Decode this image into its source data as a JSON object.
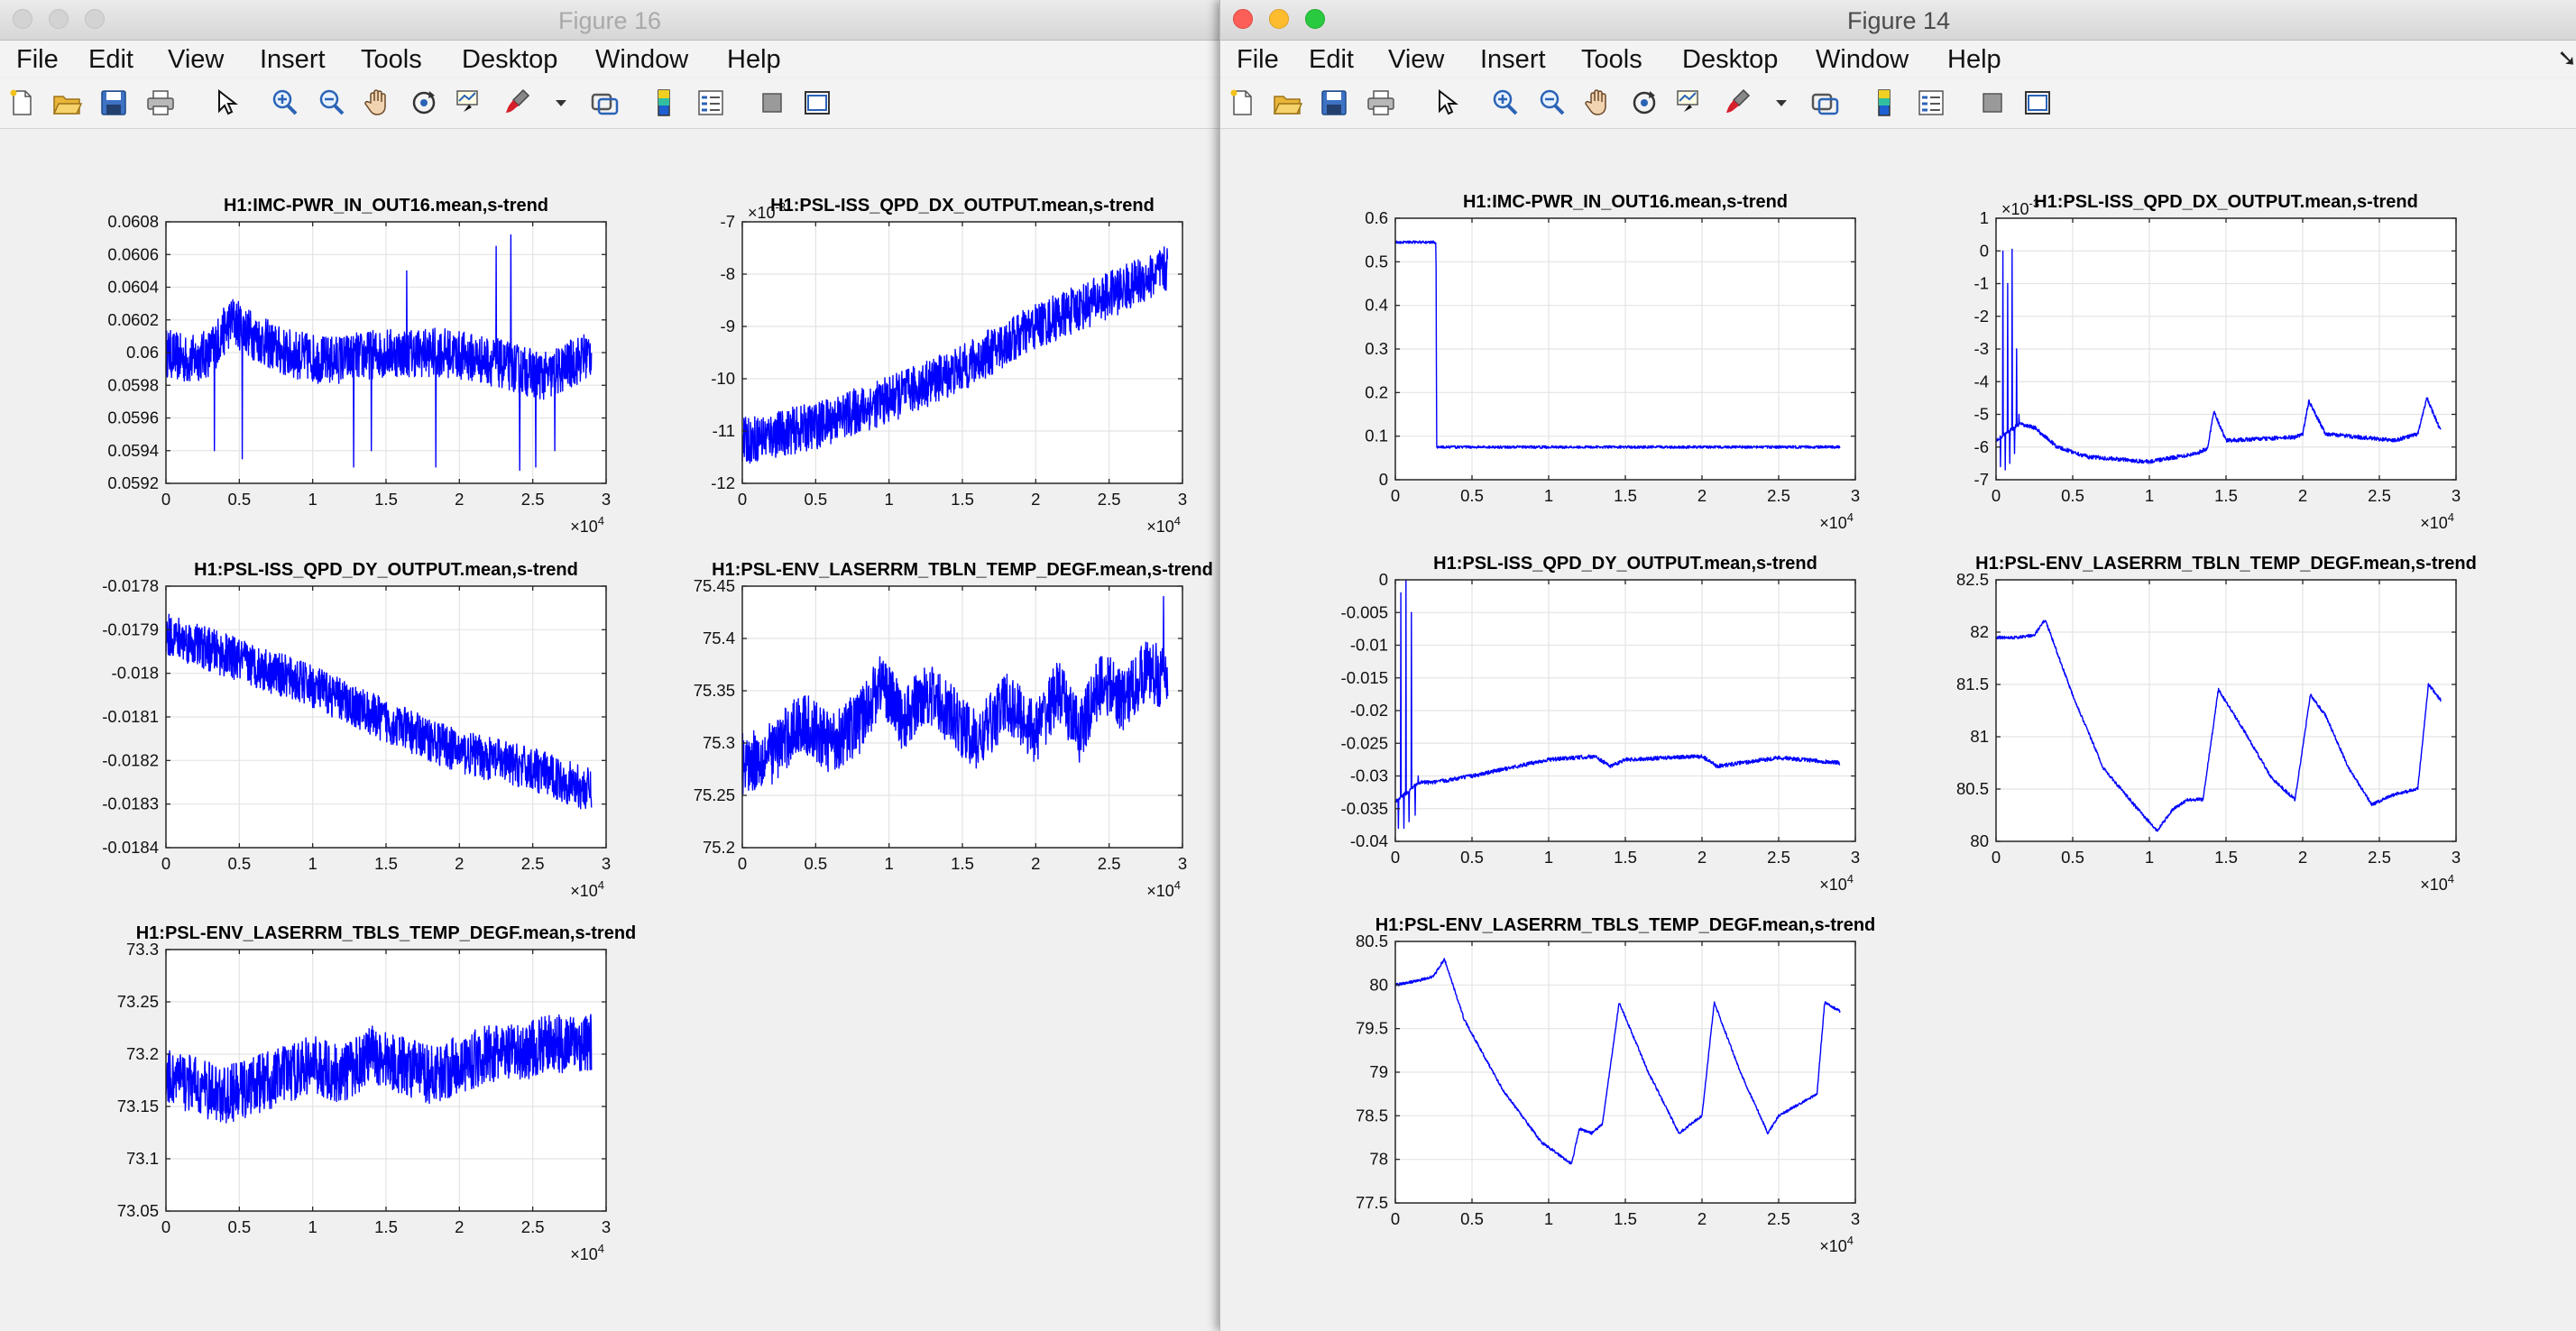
{
  "windows": [
    {
      "id": "figure-16",
      "title": "Figure 16",
      "active": false,
      "menus": [
        "File",
        "Edit",
        "View",
        "Insert",
        "Tools",
        "Desktop",
        "Window",
        "Help"
      ],
      "toolbar_icons": [
        "new-figure-icon",
        "open-file-icon",
        "save-icon",
        "print-icon",
        "edit-plot-pointer-icon",
        "zoom-in-icon",
        "zoom-out-icon",
        "pan-hand-icon",
        "rotate-3d-icon",
        "data-cursor-icon",
        "brush-icon",
        "brush-dropdown-icon",
        "link-plot-icon",
        "insert-colorbar-icon",
        "insert-legend-icon",
        "hide-plot-tools-icon",
        "show-plot-tools-icon"
      ]
    },
    {
      "id": "figure-14",
      "title": "Figure 14",
      "active": true,
      "menus": [
        "File",
        "Edit",
        "View",
        "Insert",
        "Tools",
        "Desktop",
        "Window",
        "Help"
      ],
      "toolbar_icons": [
        "new-figure-icon",
        "open-file-icon",
        "save-icon",
        "print-icon",
        "edit-plot-pointer-icon",
        "zoom-in-icon",
        "zoom-out-icon",
        "pan-hand-icon",
        "rotate-3d-icon",
        "data-cursor-icon",
        "brush-icon",
        "brush-dropdown-icon",
        "link-plot-icon",
        "insert-colorbar-icon",
        "insert-legend-icon",
        "hide-plot-tools-icon",
        "show-plot-tools-icon"
      ]
    }
  ],
  "colors": {
    "line": "#0000ff",
    "grid": "#e4e4e4",
    "axes_bg": "#ffffff"
  },
  "chart_data": [
    {
      "window": "figure-16",
      "id": "f16-imc",
      "type": "line",
      "title": "H1:IMC-PWR_IN_OUT16.mean,s-trend",
      "xlim": [
        0,
        30000
      ],
      "ylim": [
        0.0592,
        0.0608
      ],
      "x_multiplier": "×10",
      "x_exponent": "4",
      "xticks": [
        0,
        5000,
        10000,
        15000,
        20000,
        25000,
        30000
      ],
      "xtick_labels": [
        "0",
        "0.5",
        "1",
        "1.5",
        "2",
        "2.5",
        "3"
      ],
      "yticks": [
        0.0592,
        0.0594,
        0.0596,
        0.0598,
        0.06,
        0.0602,
        0.0604,
        0.0606,
        0.0608
      ],
      "ytick_labels": [
        "0.0592",
        "0.0594",
        "0.0596",
        "0.0598",
        "0.06",
        "0.0602",
        "0.0604",
        "0.0606",
        "0.0608"
      ],
      "grid": true,
      "noise": 0.00015,
      "x_end": 29000,
      "x": [
        0,
        1500,
        3000,
        4500,
        6000,
        8000,
        11000,
        15000,
        19000,
        22000,
        26000,
        29000
      ],
      "y": [
        0.06,
        0.05995,
        0.06,
        0.0602,
        0.0601,
        0.06,
        0.05995,
        0.06,
        0.06,
        0.05995,
        0.05985,
        0.06
      ],
      "spikes": [
        {
          "x": 3300,
          "y": 0.0594
        },
        {
          "x": 5200,
          "y": 0.05935
        },
        {
          "x": 12800,
          "y": 0.0593
        },
        {
          "x": 14000,
          "y": 0.0594
        },
        {
          "x": 16400,
          "y": 0.0605
        },
        {
          "x": 18400,
          "y": 0.0593
        },
        {
          "x": 22500,
          "y": 0.06065
        },
        {
          "x": 23500,
          "y": 0.06072
        },
        {
          "x": 24100,
          "y": 0.05928
        },
        {
          "x": 25200,
          "y": 0.0593
        },
        {
          "x": 26500,
          "y": 0.0594
        }
      ]
    },
    {
      "window": "figure-16",
      "id": "f16-dx",
      "type": "line",
      "title": "H1:PSL-ISS_QPD_DX_OUTPUT.mean,s-trend",
      "xlim": [
        0,
        30000
      ],
      "ylim": [
        -12,
        -7
      ],
      "x_multiplier": "×10",
      "x_exponent": "4",
      "y_multiplier": "×10",
      "y_exponent": "-3",
      "xticks": [
        0,
        5000,
        10000,
        15000,
        20000,
        25000,
        30000
      ],
      "xtick_labels": [
        "0",
        "0.5",
        "1",
        "1.5",
        "2",
        "2.5",
        "3"
      ],
      "yticks": [
        -12,
        -11,
        -10,
        -9,
        -8,
        -7
      ],
      "ytick_labels": [
        "-12",
        "-11",
        "-10",
        "-9",
        "-8",
        "-7"
      ],
      "grid": true,
      "noise": 0.45,
      "x_end": 29000,
      "x": [
        0,
        5000,
        10000,
        15000,
        20000,
        25000,
        29000
      ],
      "y": [
        -11.2,
        -10.9,
        -10.4,
        -9.8,
        -9.0,
        -8.4,
        -7.9
      ],
      "spikes": []
    },
    {
      "window": "figure-16",
      "id": "f16-dy",
      "type": "line",
      "title": "H1:PSL-ISS_QPD_DY_OUTPUT.mean,s-trend",
      "xlim": [
        0,
        30000
      ],
      "ylim": [
        -0.0184,
        -0.0178
      ],
      "x_multiplier": "×10",
      "x_exponent": "4",
      "xticks": [
        0,
        5000,
        10000,
        15000,
        20000,
        25000,
        30000
      ],
      "xtick_labels": [
        "0",
        "0.5",
        "1",
        "1.5",
        "2",
        "2.5",
        "3"
      ],
      "yticks": [
        -0.0184,
        -0.0183,
        -0.0182,
        -0.0181,
        -0.018,
        -0.0179,
        -0.0178
      ],
      "ytick_labels": [
        "-0.0184",
        "-0.0183",
        "-0.0182",
        "-0.0181",
        "-0.018",
        "-0.0179",
        "-0.0178"
      ],
      "grid": true,
      "noise": 5e-05,
      "x_end": 29000,
      "x": [
        0,
        5000,
        10000,
        15000,
        20000,
        25000,
        29000
      ],
      "y": [
        -0.01791,
        -0.01797,
        -0.01803,
        -0.01811,
        -0.01818,
        -0.01822,
        -0.01827
      ],
      "spikes": []
    },
    {
      "window": "figure-16",
      "id": "f16-tbln",
      "type": "line",
      "title": "H1:PSL-ENV_LASERRM_TBLN_TEMP_DEGF.mean,s-trend",
      "xlim": [
        0,
        30000
      ],
      "ylim": [
        75.2,
        75.45
      ],
      "x_multiplier": "×10",
      "x_exponent": "4",
      "xticks": [
        0,
        5000,
        10000,
        15000,
        20000,
        25000,
        30000
      ],
      "xtick_labels": [
        "0",
        "0.5",
        "1",
        "1.5",
        "2",
        "2.5",
        "3"
      ],
      "yticks": [
        75.2,
        75.25,
        75.3,
        75.35,
        75.4,
        75.45
      ],
      "ytick_labels": [
        "75.2",
        "75.25",
        "75.3",
        "75.35",
        "75.4",
        "75.45"
      ],
      "grid": true,
      "noise": 0.03,
      "x_end": 29000,
      "x": [
        0,
        2000,
        4000,
        6000,
        8000,
        9500,
        11000,
        12500,
        14000,
        16000,
        18000,
        20000,
        21500,
        23000,
        24500,
        26000,
        27500,
        29000
      ],
      "y": [
        75.28,
        75.29,
        75.32,
        75.3,
        75.32,
        75.36,
        75.32,
        75.35,
        75.33,
        75.3,
        75.34,
        75.31,
        75.35,
        75.31,
        75.36,
        75.34,
        75.37,
        75.36
      ],
      "spikes": [
        {
          "x": 28700,
          "y": 75.44
        }
      ]
    },
    {
      "window": "figure-16",
      "id": "f16-tbls",
      "type": "line",
      "title": "H1:PSL-ENV_LASERRM_TBLS_TEMP_DEGF.mean,s-trend",
      "xlim": [
        0,
        30000
      ],
      "ylim": [
        73.05,
        73.3
      ],
      "x_multiplier": "×10",
      "x_exponent": "4",
      "xticks": [
        0,
        5000,
        10000,
        15000,
        20000,
        25000,
        30000
      ],
      "xtick_labels": [
        "0",
        "0.5",
        "1",
        "1.5",
        "2",
        "2.5",
        "3"
      ],
      "yticks": [
        73.05,
        73.1,
        73.15,
        73.2,
        73.25,
        73.3
      ],
      "ytick_labels": [
        "73.05",
        "73.1",
        "73.15",
        "73.2",
        "73.25",
        "73.3"
      ],
      "grid": true,
      "noise": 0.028,
      "x_end": 29000,
      "x": [
        0,
        2000,
        4000,
        6000,
        8000,
        10000,
        12000,
        14000,
        16000,
        18000,
        20000,
        22000,
        24000,
        26000,
        29000
      ],
      "y": [
        73.18,
        73.17,
        73.16,
        73.17,
        73.18,
        73.19,
        73.18,
        73.2,
        73.19,
        73.18,
        73.19,
        73.2,
        73.2,
        73.21,
        73.21
      ],
      "spikes": []
    },
    {
      "window": "figure-14",
      "id": "f14-imc",
      "type": "line",
      "title": "H1:IMC-PWR_IN_OUT16.mean,s-trend",
      "xlim": [
        0,
        30000
      ],
      "ylim": [
        0,
        0.6
      ],
      "x_multiplier": "×10",
      "x_exponent": "4",
      "xticks": [
        0,
        5000,
        10000,
        15000,
        20000,
        25000,
        30000
      ],
      "xtick_labels": [
        "0",
        "0.5",
        "1",
        "1.5",
        "2",
        "2.5",
        "3"
      ],
      "yticks": [
        0,
        0.1,
        0.2,
        0.3,
        0.4,
        0.5,
        0.6
      ],
      "ytick_labels": [
        "0",
        "0.1",
        "0.2",
        "0.3",
        "0.4",
        "0.5",
        "0.6"
      ],
      "grid": true,
      "noise": 0.003,
      "x_end": 29000,
      "x": [
        0,
        2650,
        2700,
        29000
      ],
      "y": [
        0.545,
        0.545,
        0.075,
        0.075
      ],
      "spikes": []
    },
    {
      "window": "figure-14",
      "id": "f14-dx",
      "type": "line",
      "title": "H1:PSL-ISS_QPD_DX_OUTPUT.mean,s-trend",
      "xlim": [
        0,
        30000
      ],
      "ylim": [
        -7,
        1
      ],
      "x_multiplier": "×10",
      "x_exponent": "4",
      "y_multiplier": "×10",
      "y_exponent": "-3",
      "xticks": [
        0,
        5000,
        10000,
        15000,
        20000,
        25000,
        30000
      ],
      "xtick_labels": [
        "0",
        "0.5",
        "1",
        "1.5",
        "2",
        "2.5",
        "3"
      ],
      "yticks": [
        -7,
        -6,
        -5,
        -4,
        -3,
        -2,
        -1,
        0,
        1
      ],
      "ytick_labels": [
        "-7",
        "-6",
        "-5",
        "-4",
        "-3",
        "-2",
        "-1",
        "0",
        "1"
      ],
      "grid": true,
      "noise": 0.06,
      "x_end": 29000,
      "x": [
        0,
        1500,
        2500,
        4000,
        6000,
        10000,
        13000,
        13800,
        14200,
        15000,
        19500,
        20000,
        20400,
        21500,
        26000,
        27500,
        28100,
        29000
      ],
      "y": [
        -5.8,
        -5.3,
        -5.4,
        -6.0,
        -6.3,
        -6.45,
        -6.2,
        -6.05,
        -4.9,
        -5.8,
        -5.7,
        -5.6,
        -4.6,
        -5.6,
        -5.8,
        -5.6,
        -4.5,
        -5.5
      ],
      "spikes": [
        {
          "x": 300,
          "y": -6.6
        },
        {
          "x": 450,
          "y": 0.0
        },
        {
          "x": 600,
          "y": -6.7
        },
        {
          "x": 750,
          "y": -1.0
        },
        {
          "x": 900,
          "y": -6.5
        },
        {
          "x": 1050,
          "y": 0.05
        },
        {
          "x": 1200,
          "y": -6.2
        },
        {
          "x": 1350,
          "y": -3.0
        },
        {
          "x": 1500,
          "y": -5.0
        }
      ]
    },
    {
      "window": "figure-14",
      "id": "f14-dy",
      "type": "line",
      "title": "H1:PSL-ISS_QPD_DY_OUTPUT.mean,s-trend",
      "xlim": [
        0,
        30000
      ],
      "ylim": [
        -0.04,
        0
      ],
      "x_multiplier": "×10",
      "x_exponent": "4",
      "xticks": [
        0,
        5000,
        10000,
        15000,
        20000,
        25000,
        30000
      ],
      "xtick_labels": [
        "0",
        "0.5",
        "1",
        "1.5",
        "2",
        "2.5",
        "3"
      ],
      "yticks": [
        -0.04,
        -0.035,
        -0.03,
        -0.025,
        -0.02,
        -0.015,
        -0.01,
        -0.005,
        0
      ],
      "ytick_labels": [
        "-0.04",
        "-0.035",
        "-0.03",
        "-0.025",
        "-0.02",
        "-0.015",
        "-0.01",
        "-0.005",
        "0"
      ],
      "grid": true,
      "noise": 0.0003,
      "x_end": 29000,
      "x": [
        0,
        1500,
        2500,
        5000,
        10000,
        13000,
        14000,
        15000,
        20000,
        21000,
        25000,
        29000
      ],
      "y": [
        -0.034,
        -0.031,
        -0.031,
        -0.03,
        -0.0275,
        -0.027,
        -0.0285,
        -0.0275,
        -0.027,
        -0.0285,
        -0.0272,
        -0.028
      ],
      "spikes": [
        {
          "x": 200,
          "y": -0.038
        },
        {
          "x": 350,
          "y": -0.002
        },
        {
          "x": 550,
          "y": -0.038
        },
        {
          "x": 700,
          "y": 0.0
        },
        {
          "x": 900,
          "y": -0.037
        },
        {
          "x": 1050,
          "y": -0.005
        },
        {
          "x": 1300,
          "y": -0.036
        },
        {
          "x": 1500,
          "y": -0.03
        }
      ]
    },
    {
      "window": "figure-14",
      "id": "f14-tbln",
      "type": "line",
      "title": "H1:PSL-ENV_LASERRM_TBLN_TEMP_DEGF.mean,s-trend",
      "xlim": [
        0,
        30000
      ],
      "ylim": [
        80,
        82.5
      ],
      "x_multiplier": "×10",
      "x_exponent": "4",
      "xticks": [
        0,
        5000,
        10000,
        15000,
        20000,
        25000,
        30000
      ],
      "xtick_labels": [
        "0",
        "0.5",
        "1",
        "1.5",
        "2",
        "2.5",
        "3"
      ],
      "yticks": [
        80,
        80.5,
        81,
        81.5,
        82,
        82.5
      ],
      "ytick_labels": [
        "80",
        "80.5",
        "81",
        "81.5",
        "82",
        "82.5"
      ],
      "grid": true,
      "noise": 0.015,
      "x_end": 29000,
      "x": [
        0,
        1500,
        2500,
        3200,
        5000,
        7000,
        9000,
        10500,
        11500,
        12500,
        13500,
        14500,
        16000,
        18000,
        19500,
        20500,
        21500,
        23000,
        24500,
        26000,
        27500,
        28200,
        29000
      ],
      "y": [
        81.95,
        81.95,
        81.97,
        82.12,
        81.4,
        80.7,
        80.35,
        80.1,
        80.3,
        80.4,
        80.4,
        81.45,
        81.1,
        80.6,
        80.4,
        81.4,
        81.2,
        80.7,
        80.35,
        80.45,
        80.5,
        81.5,
        81.35
      ],
      "spikes": []
    },
    {
      "window": "figure-14",
      "id": "f14-tbls",
      "type": "line",
      "title": "H1:PSL-ENV_LASERRM_TBLS_TEMP_DEGF.mean,s-trend",
      "xlim": [
        0,
        30000
      ],
      "ylim": [
        77.5,
        80.5
      ],
      "x_multiplier": "×10",
      "x_exponent": "4",
      "xticks": [
        0,
        5000,
        10000,
        15000,
        20000,
        25000,
        30000
      ],
      "xtick_labels": [
        "0",
        "0.5",
        "1",
        "1.5",
        "2",
        "2.5",
        "3"
      ],
      "yticks": [
        77.5,
        78,
        78.5,
        79,
        79.5,
        80,
        80.5
      ],
      "ytick_labels": [
        "77.5",
        "78",
        "78.5",
        "79",
        "79.5",
        "80",
        "80.5"
      ],
      "grid": true,
      "noise": 0.015,
      "x_end": 29000,
      "x": [
        0,
        1500,
        2500,
        3200,
        4500,
        7000,
        9500,
        11500,
        12000,
        12800,
        13500,
        14600,
        16500,
        18500,
        20000,
        20800,
        22500,
        24300,
        25000,
        26500,
        27500,
        28000,
        29000
      ],
      "y": [
        80.0,
        80.05,
        80.1,
        80.3,
        79.6,
        78.8,
        78.2,
        77.95,
        78.35,
        78.3,
        78.4,
        79.8,
        79.0,
        78.3,
        78.5,
        79.8,
        79.0,
        78.3,
        78.5,
        78.65,
        78.75,
        79.8,
        79.7
      ],
      "spikes": []
    }
  ]
}
